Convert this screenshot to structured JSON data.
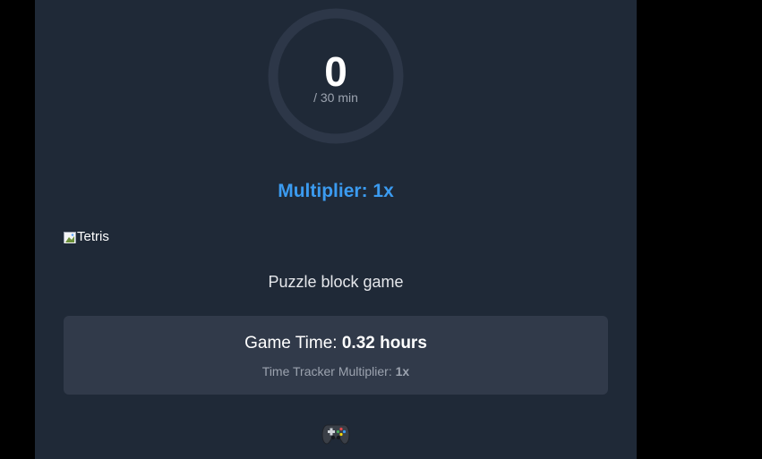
{
  "timer": {
    "value": "0",
    "unit": "/ 30 min",
    "progress": 0
  },
  "multiplier": {
    "label": "Multiplier: 1x"
  },
  "game": {
    "image_alt": "Tetris",
    "description": "Puzzle block game"
  },
  "stats": {
    "game_time_label": "Game Time: ",
    "game_time_value": "0.32 hours",
    "tracker_label": "Time Tracker Multiplier: ",
    "tracker_value": "1x"
  },
  "icons": {
    "controller": "game-controller-icon",
    "broken_image": "broken-image-icon"
  },
  "colors": {
    "panel_bg": "#1f2937",
    "ring_track": "#2d3748",
    "accent": "#3b9bf0",
    "card_bg": "#313a4a"
  }
}
